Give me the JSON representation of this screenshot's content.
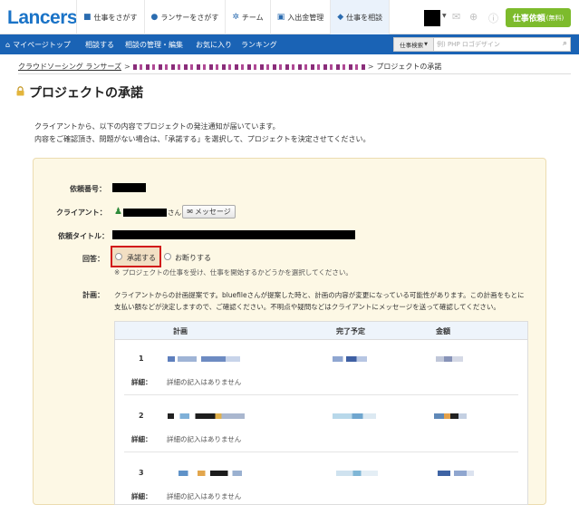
{
  "header": {
    "logo": "Lancers",
    "nav": [
      {
        "label": "仕事をさがす",
        "icon": "folder-icon"
      },
      {
        "label": "ランサーをさがす",
        "icon": "user-icon"
      },
      {
        "label": "チーム",
        "icon": "team-icon"
      },
      {
        "label": "入出金管理",
        "icon": "wallet-icon"
      },
      {
        "label": "仕事を相談",
        "icon": "chat-icon"
      }
    ],
    "order_button": "仕事依頼",
    "order_button_sub": "(無料)"
  },
  "subnav": {
    "items": [
      "マイページトップ",
      "相談する",
      "相談の管理・編集",
      "お気に入り",
      "ランキング"
    ],
    "search_category": "仕事検索",
    "search_placeholder": "例) PHP ロゴデザイン"
  },
  "breadcrumb": {
    "root": "クラウドソーシング ランサーズ",
    "current": "プロジェクトの承諾"
  },
  "page": {
    "title": "プロジェクトの承諾",
    "intro_line1": "クライアントから、以下の内容でプロジェクトの発注通知が届いています。",
    "intro_line2": "内容をご確認頂き、問題がない場合は、「承諾する」を選択して、プロジェクトを決定させてください。"
  },
  "form": {
    "request_no_label": "依頼番号：",
    "client_label": "クライアント：",
    "client_suffix": "さん",
    "message_button": "メッセージ",
    "request_title_label": "依頼タイトル：",
    "answer_label": "回答：",
    "accept_label": "承諾する",
    "decline_label": "お断りする",
    "answer_note": "※ プロジェクトの仕事を受け、仕事を開始するかどうかを選択してください。",
    "plan_label": "計画：",
    "plan_desc": "クライアントからの計画提案です。bluefileさんが提案した時と、計画の内容が変更になっている可能性があります。この計画をもとに支払い額などが決定しますので、ご確認ください。不明点や疑問などはクライアントにメッセージを送って確認してください。"
  },
  "plan_table": {
    "headers": [
      "計画",
      "完了予定",
      "金額"
    ],
    "rows": [
      {
        "num": "1",
        "detail_label": "詳細：",
        "detail": "詳細の記入はありません"
      },
      {
        "num": "2",
        "detail_label": "詳細：",
        "detail": "詳細の記入はありません"
      },
      {
        "num": "3",
        "detail_label": "詳細：",
        "detail": "詳細の記入はありません"
      }
    ]
  },
  "colors": {
    "brand": "#1a63b5",
    "order_button": "#7dbb2c",
    "highlight": "#d21a1a",
    "panel_bg": "#fdf8e5"
  }
}
